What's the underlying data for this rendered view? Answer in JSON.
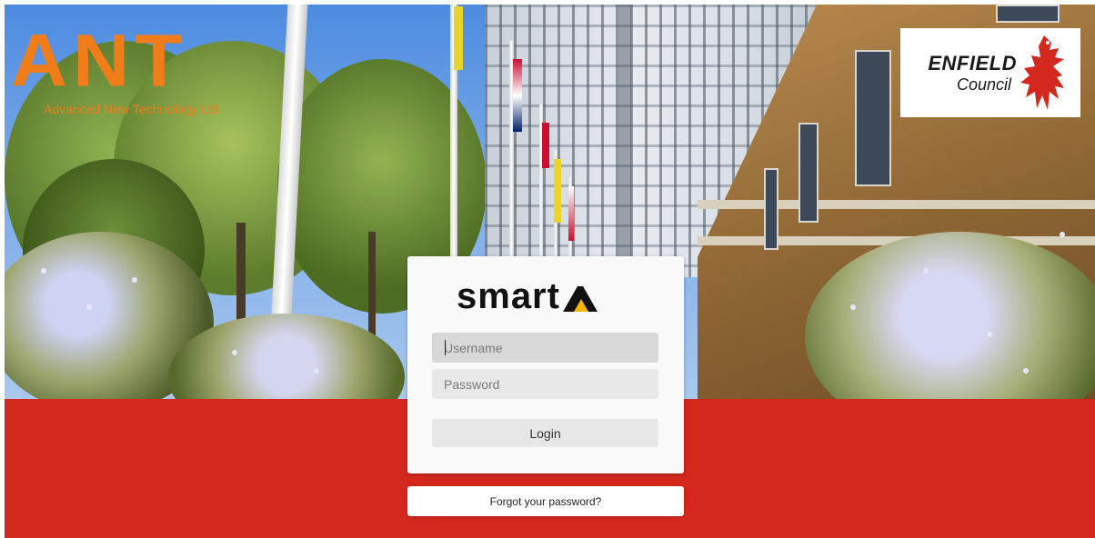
{
  "branding": {
    "ant_logo_text": "ANT",
    "ant_logo_subtitle": "Advanced New Technology Ltd",
    "council_name": "ENFIELD",
    "council_suffix": "Council",
    "app_logo_text": "smart",
    "brand_orange": "#f07d1a",
    "accent_red": "#d4281e",
    "smarta_yellow": "#f5b400"
  },
  "login": {
    "username_placeholder": "Username",
    "password_placeholder": "Password",
    "login_label": "Login",
    "forgot_label": "Forgot your password?"
  }
}
